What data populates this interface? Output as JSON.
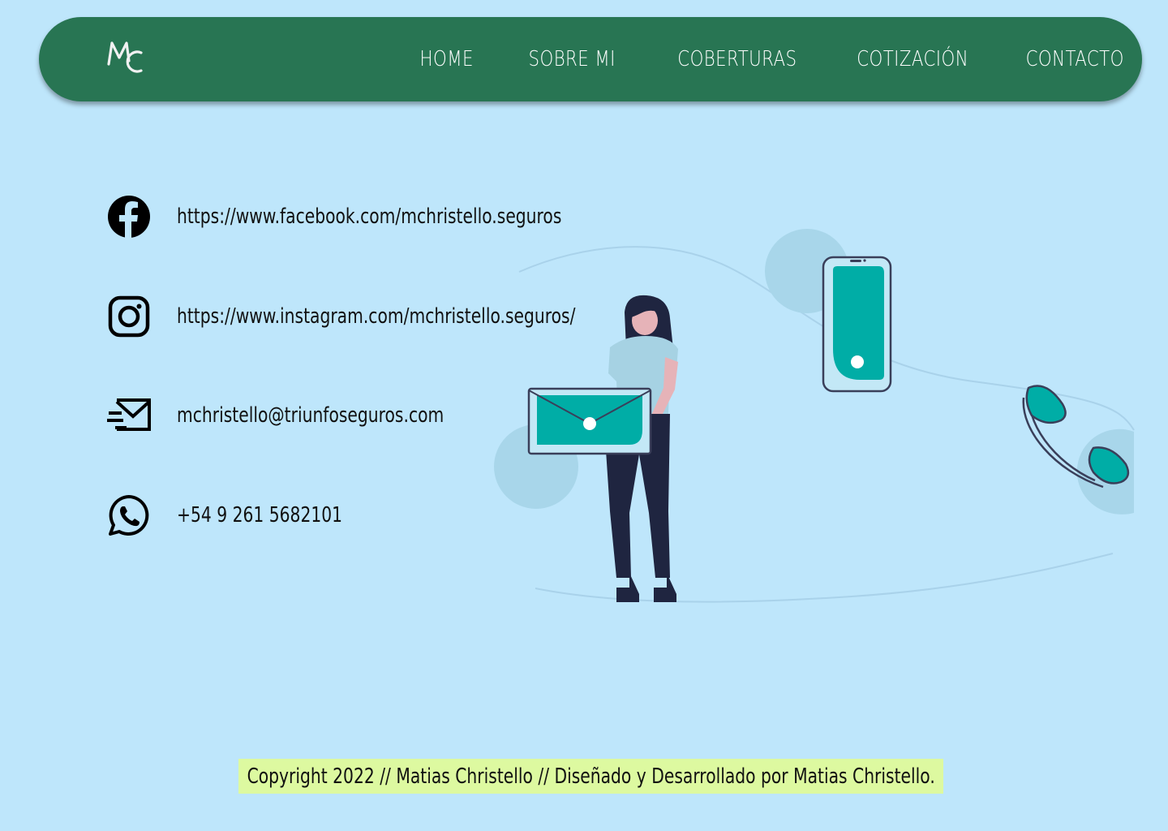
{
  "navbar": {
    "logo_text": "MC",
    "items": [
      {
        "label": "HOME"
      },
      {
        "label": "SOBRE MI"
      },
      {
        "label": "COBERTURAS"
      },
      {
        "label": "COTIZACIÓN"
      },
      {
        "label": "CONTACTO"
      }
    ]
  },
  "contacts": [
    {
      "icon": "facebook-icon",
      "text": "https://www.facebook.com/mchristello.seguros"
    },
    {
      "icon": "instagram-icon",
      "text": "https://www.instagram.com/mchristello.seguros/"
    },
    {
      "icon": "mail-icon",
      "text": "mchristello@triunfoseguros.com"
    },
    {
      "icon": "whatsapp-icon",
      "text": "+54 9 261 5682101"
    }
  ],
  "footer": {
    "text": "Copyright 2022 // Matias Christello // Diseñado y Desarrollado por Matias Christello."
  },
  "colors": {
    "background": "#bee6fb",
    "navbar": "#287553",
    "accent_teal": "#00ada6",
    "footer_bg": "#ddf9a0"
  }
}
